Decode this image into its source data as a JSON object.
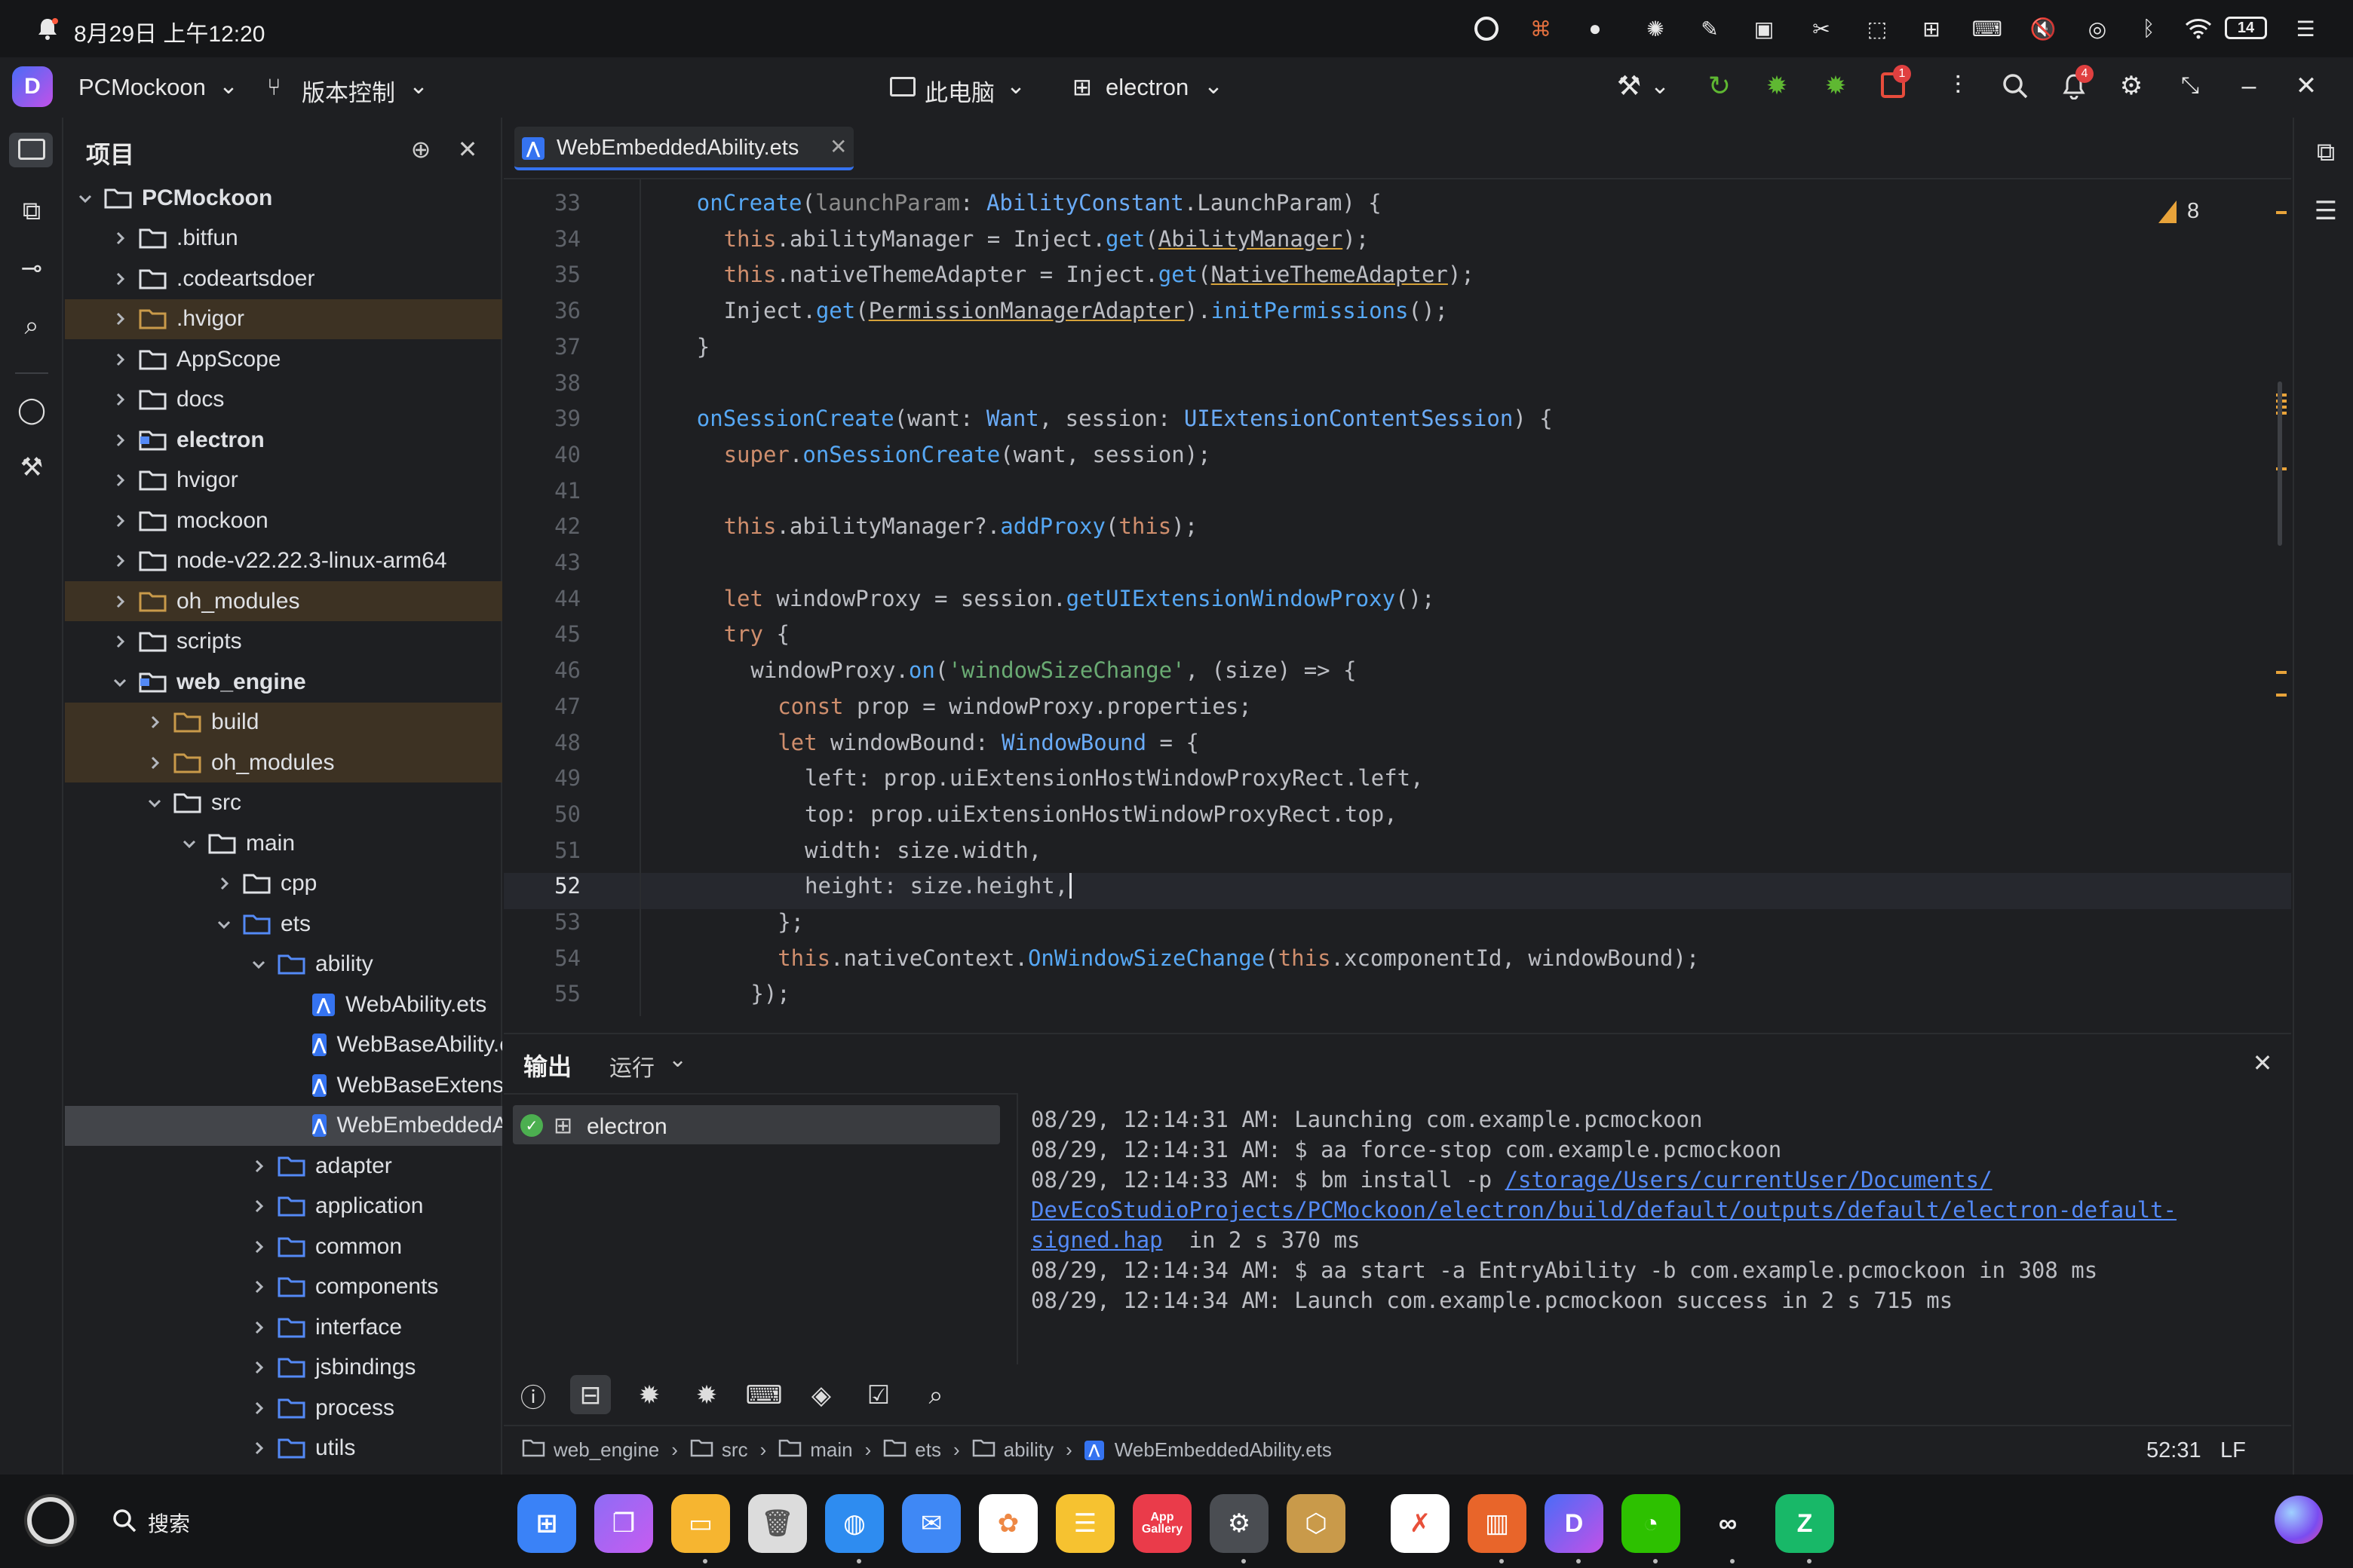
{
  "status_bar": {
    "datetime": "8月29日 上午12:20",
    "battery": "14"
  },
  "title_bar": {
    "project_name": "PCMockoon",
    "vcs_label": "版本控制",
    "device_label": "此电脑",
    "module_label": "electron",
    "problems_badge": "1",
    "notifications_badge": "4"
  },
  "project_panel": {
    "title": "项目",
    "tree": [
      {
        "label": "PCMockoon",
        "level": 0,
        "expanded": true,
        "kind": "folder",
        "style": "bold"
      },
      {
        "label": ".bitfun",
        "level": 1,
        "expanded": false,
        "kind": "folder"
      },
      {
        "label": ".codeartsdoer",
        "level": 1,
        "expanded": false,
        "kind": "folder"
      },
      {
        "label": ".hvigor",
        "level": 1,
        "expanded": false,
        "kind": "folder-orange",
        "excluded": true
      },
      {
        "label": "AppScope",
        "level": 1,
        "expanded": false,
        "kind": "folder"
      },
      {
        "label": "docs",
        "level": 1,
        "expanded": false,
        "kind": "folder"
      },
      {
        "label": "electron",
        "level": 1,
        "expanded": false,
        "kind": "module",
        "style": "bold"
      },
      {
        "label": "hvigor",
        "level": 1,
        "expanded": false,
        "kind": "folder"
      },
      {
        "label": "mockoon",
        "level": 1,
        "expanded": false,
        "kind": "folder"
      },
      {
        "label": "node-v22.22.3-linux-arm64",
        "level": 1,
        "expanded": false,
        "kind": "folder"
      },
      {
        "label": "oh_modules",
        "level": 1,
        "expanded": false,
        "kind": "folder-orange",
        "excluded": true
      },
      {
        "label": "scripts",
        "level": 1,
        "expanded": false,
        "kind": "folder"
      },
      {
        "label": "web_engine",
        "level": 1,
        "expanded": true,
        "kind": "module",
        "style": "bold"
      },
      {
        "label": "build",
        "level": 2,
        "expanded": false,
        "kind": "folder-orange",
        "excluded": true
      },
      {
        "label": "oh_modules",
        "level": 2,
        "expanded": false,
        "kind": "folder-orange",
        "excluded": true
      },
      {
        "label": "src",
        "level": 2,
        "expanded": true,
        "kind": "folder"
      },
      {
        "label": "main",
        "level": 3,
        "expanded": true,
        "kind": "folder"
      },
      {
        "label": "cpp",
        "level": 4,
        "expanded": false,
        "kind": "folder"
      },
      {
        "label": "ets",
        "level": 4,
        "expanded": true,
        "kind": "folder-blue"
      },
      {
        "label": "ability",
        "level": 5,
        "expanded": true,
        "kind": "folder-blue"
      },
      {
        "label": "WebAbility.ets",
        "level": 6,
        "kind": "file"
      },
      {
        "label": "WebBaseAbility.ets",
        "level": 6,
        "kind": "file"
      },
      {
        "label": "WebBaseExtensionAbility.ets",
        "level": 6,
        "kind": "file"
      },
      {
        "label": "WebEmbeddedAbility.ets",
        "level": 6,
        "kind": "file",
        "selected": true
      },
      {
        "label": "adapter",
        "level": 5,
        "expanded": false,
        "kind": "folder-blue"
      },
      {
        "label": "application",
        "level": 5,
        "expanded": false,
        "kind": "folder-blue"
      },
      {
        "label": "common",
        "level": 5,
        "expanded": false,
        "kind": "folder-blue"
      },
      {
        "label": "components",
        "level": 5,
        "expanded": false,
        "kind": "folder-blue"
      },
      {
        "label": "interface",
        "level": 5,
        "expanded": false,
        "kind": "folder-blue"
      },
      {
        "label": "jsbindings",
        "level": 5,
        "expanded": false,
        "kind": "folder-blue"
      },
      {
        "label": "process",
        "level": 5,
        "expanded": false,
        "kind": "folder-blue"
      },
      {
        "label": "utils",
        "level": 5,
        "expanded": false,
        "kind": "folder-blue"
      }
    ]
  },
  "editor": {
    "tab_label": "WebEmbeddedAbility.ets",
    "warning_count": "8",
    "current_line": 52,
    "lines": [
      {
        "n": "33",
        "segs": [
          [
            "fn",
            "onCreate"
          ],
          [
            "",
            "("
          ],
          [
            "pm",
            "launchParam"
          ],
          [
            "",
            ": "
          ],
          [
            "ty",
            "AbilityConstant"
          ],
          [
            "",
            ".LaunchParam) {"
          ]
        ],
        "indent": 2
      },
      {
        "n": "34",
        "segs": [
          [
            "kw",
            "this"
          ],
          [
            "",
            ".abilityManager = Inject."
          ],
          [
            "fn",
            "get"
          ],
          [
            "",
            "("
          ],
          [
            "ul",
            "AbilityManager"
          ],
          [
            "",
            ");"
          ]
        ],
        "indent": 4
      },
      {
        "n": "35",
        "segs": [
          [
            "kw",
            "this"
          ],
          [
            "",
            ".nativeThemeAdapter = Inject."
          ],
          [
            "fn",
            "get"
          ],
          [
            "",
            "("
          ],
          [
            "ul",
            "NativeThemeAdapter"
          ],
          [
            "",
            ");"
          ]
        ],
        "indent": 4
      },
      {
        "n": "36",
        "segs": [
          [
            "",
            "Inject."
          ],
          [
            "fn",
            "get"
          ],
          [
            "",
            "("
          ],
          [
            "ul",
            "PermissionManagerAdapter"
          ],
          [
            "",
            ")."
          ],
          [
            "fn",
            "initPermissions"
          ],
          [
            "",
            "();"
          ]
        ],
        "indent": 4
      },
      {
        "n": "37",
        "segs": [
          [
            "",
            "}"
          ]
        ],
        "indent": 2
      },
      {
        "n": "38",
        "segs": [],
        "indent": 0
      },
      {
        "n": "39",
        "segs": [
          [
            "fn",
            "onSessionCreate"
          ],
          [
            "",
            "(want: "
          ],
          [
            "ty",
            "Want"
          ],
          [
            "",
            ", session: "
          ],
          [
            "ty",
            "UIExtensionContentSession"
          ],
          [
            "",
            ") {"
          ]
        ],
        "indent": 2
      },
      {
        "n": "40",
        "segs": [
          [
            "kw",
            "super"
          ],
          [
            "",
            "."
          ],
          [
            "fn",
            "onSessionCreate"
          ],
          [
            "",
            "(want, session);"
          ]
        ],
        "indent": 4
      },
      {
        "n": "41",
        "segs": [],
        "indent": 0
      },
      {
        "n": "42",
        "segs": [
          [
            "kw",
            "this"
          ],
          [
            "",
            ".abilityManager?."
          ],
          [
            "fn",
            "addProxy"
          ],
          [
            "",
            "("
          ],
          [
            "kw",
            "this"
          ],
          [
            "",
            ");"
          ]
        ],
        "indent": 4
      },
      {
        "n": "43",
        "segs": [],
        "indent": 0
      },
      {
        "n": "44",
        "segs": [
          [
            "kw",
            "let"
          ],
          [
            "",
            " windowProxy = session."
          ],
          [
            "fn",
            "getUIExtensionWindowProxy"
          ],
          [
            "",
            "();"
          ]
        ],
        "indent": 4
      },
      {
        "n": "45",
        "segs": [
          [
            "kw",
            "try"
          ],
          [
            "",
            " {"
          ]
        ],
        "indent": 4
      },
      {
        "n": "46",
        "segs": [
          [
            "",
            "windowProxy."
          ],
          [
            "fn",
            "on"
          ],
          [
            "",
            "("
          ],
          [
            "st",
            "'windowSizeChange'"
          ],
          [
            "",
            ", (size) => {"
          ]
        ],
        "indent": 6
      },
      {
        "n": "47",
        "segs": [
          [
            "kw",
            "const"
          ],
          [
            "",
            " prop = windowProxy.properties;"
          ]
        ],
        "indent": 8
      },
      {
        "n": "48",
        "segs": [
          [
            "kw",
            "let"
          ],
          [
            "",
            " windowBound: "
          ],
          [
            "ty",
            "WindowBound"
          ],
          [
            "",
            " = {"
          ]
        ],
        "indent": 8
      },
      {
        "n": "49",
        "segs": [
          [
            "",
            "left: prop.uiExtensionHostWindowProxyRect.left,"
          ]
        ],
        "indent": 10
      },
      {
        "n": "50",
        "segs": [
          [
            "",
            "top: prop.uiExtensionHostWindowProxyRect.top,"
          ]
        ],
        "indent": 10
      },
      {
        "n": "51",
        "segs": [
          [
            "",
            "width: size.width,"
          ]
        ],
        "indent": 10
      },
      {
        "n": "52",
        "segs": [
          [
            "",
            "height: size.height,"
          ]
        ],
        "indent": 10
      },
      {
        "n": "53",
        "segs": [
          [
            "",
            "};"
          ]
        ],
        "indent": 8
      },
      {
        "n": "54",
        "segs": [
          [
            "kw",
            "this"
          ],
          [
            "",
            ".nativeContext."
          ],
          [
            "fn",
            "OnWindowSizeChange"
          ],
          [
            "",
            "("
          ],
          [
            "kw",
            "this"
          ],
          [
            "",
            ".xcomponentId, windowBound);"
          ]
        ],
        "indent": 8
      },
      {
        "n": "55",
        "segs": [
          [
            "",
            "});"
          ]
        ],
        "indent": 6
      }
    ]
  },
  "output": {
    "tab_output": "输出",
    "tab_run": "运行",
    "run_item": "electron",
    "log": [
      "08/29, 12:14:31 AM: Launching com.example.pcmockoon",
      "08/29, 12:14:31 AM: $ aa force-stop com.example.pcmockoon",
      "08/29, 12:14:33 AM: $ bm install -p ",
      "DevEcoStudioProjects/PCMockoon/electron/build/default/outputs/default/electron-default-",
      "signed.hap",
      "08/29, 12:14:34 AM: $ aa start -a EntryAbility -b com.example.pcmockoon in 308 ms",
      "08/29, 12:14:34 AM: Launch com.example.pcmockoon success in 2 s 715 ms"
    ],
    "log_link_part1": "/storage/Users/currentUser/Documents/",
    "log_suffix": "  in 2 s 370 ms"
  },
  "breadcrumb": {
    "items": [
      "web_engine",
      "src",
      "main",
      "ets",
      "ability",
      "WebEmbeddedAbility.ets"
    ],
    "position": "52:31",
    "line_ending": "LF"
  },
  "taskbar": {
    "search_label": "搜索",
    "appgallery_label_1": "App",
    "appgallery_label_2": "Gallery"
  },
  "colors": {
    "background": "#1e1f22",
    "accent_blue": "#3573f0",
    "excluded_bg": "#3d3223",
    "keyword": "#cf8e6d",
    "function": "#56a8f5",
    "string": "#6aab73"
  }
}
